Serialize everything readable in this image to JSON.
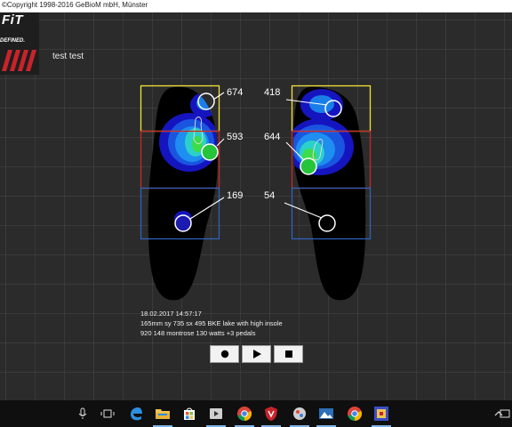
{
  "window": {
    "title": "©Copyright 1998-2016 GeBioM mbH, Münster"
  },
  "logo": {
    "brand": "FiT",
    "tagline": "DEFINED."
  },
  "subject_name": "test test",
  "zones": {
    "left": {
      "forefoot": "674",
      "midfoot": "593",
      "rearfoot": "169"
    },
    "right": {
      "forefoot": "418",
      "midfoot": "644",
      "rearfoot": "54"
    }
  },
  "info": {
    "line1": "18.02.2017 14:57:17",
    "line2": "165mm sy 735 sx 495 BKE lake with high  insole",
    "line3": "920 148 montrose 130 watts +3 pedals"
  },
  "controls": {
    "record_icon": "record-icon",
    "play_icon": "play-icon",
    "stop_icon": "stop-icon"
  },
  "colors": {
    "forefoot_box": "#f2e33a",
    "midfoot_box": "#c42a2a",
    "rearfoot_box": "#2f62b8",
    "pressure_low": "#1414c8",
    "pressure_mid": "#1e8ef0",
    "pressure_high": "#3ddc4a"
  },
  "taskbar": {
    "icons": [
      "microphone-icon",
      "task-view-icon",
      "edge-icon",
      "file-explorer-icon",
      "store-icon",
      "media-icon",
      "chrome-icon",
      "shield-app-icon",
      "settings-app-icon",
      "photos-icon",
      "chrome-icon",
      "app-icon",
      "tray-chevron-icon",
      "notification-icon"
    ]
  }
}
